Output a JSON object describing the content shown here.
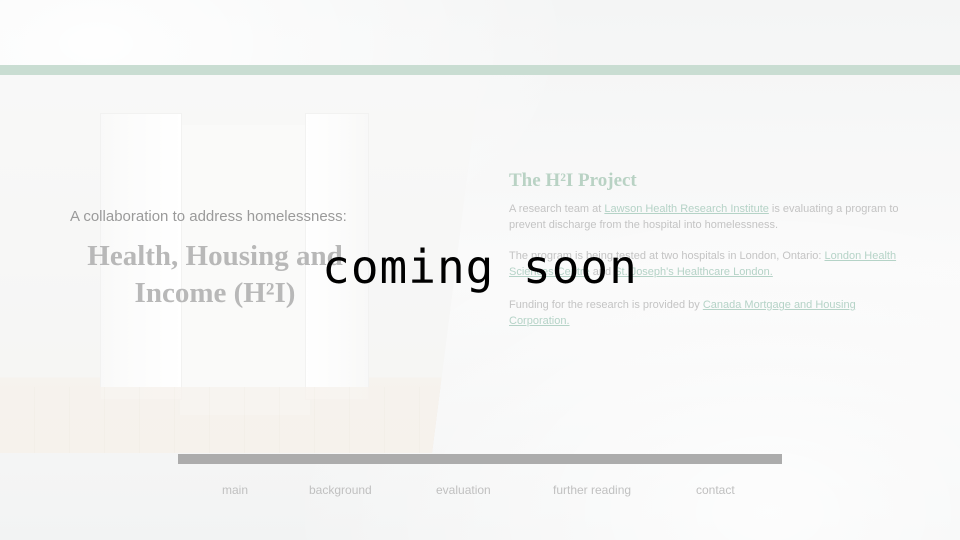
{
  "hero": {
    "kicker": "A collaboration to address homelessness:",
    "title": "Health, Housing and Income (H²I)"
  },
  "project": {
    "heading": "The H²I Project",
    "p1_before": "A research team at ",
    "p1_link": "Lawson Health Research Institute",
    "p1_after": " is evaluating a program to prevent discharge from the hospital into homelessness.",
    "p2_before": "The program is being tested at two hospitals in London, Ontario: ",
    "p2_link1": "London Health Sciences Centre",
    "p2_mid": " and ",
    "p2_link2": "St. Joseph's Healthcare London.",
    "p3_before": "Funding for the research is provided by ",
    "p3_link": "Canada Mortgage and Housing Corporation."
  },
  "nav": {
    "items": [
      "main",
      "background",
      "evaluation",
      "further reading",
      "contact"
    ]
  },
  "overlay": {
    "text": "coming soon"
  },
  "colors": {
    "accent_bar": "#c9ddd2",
    "heading": "#b9d2c4",
    "link": "#b5d3c7",
    "scrollbar": "#acacac"
  }
}
